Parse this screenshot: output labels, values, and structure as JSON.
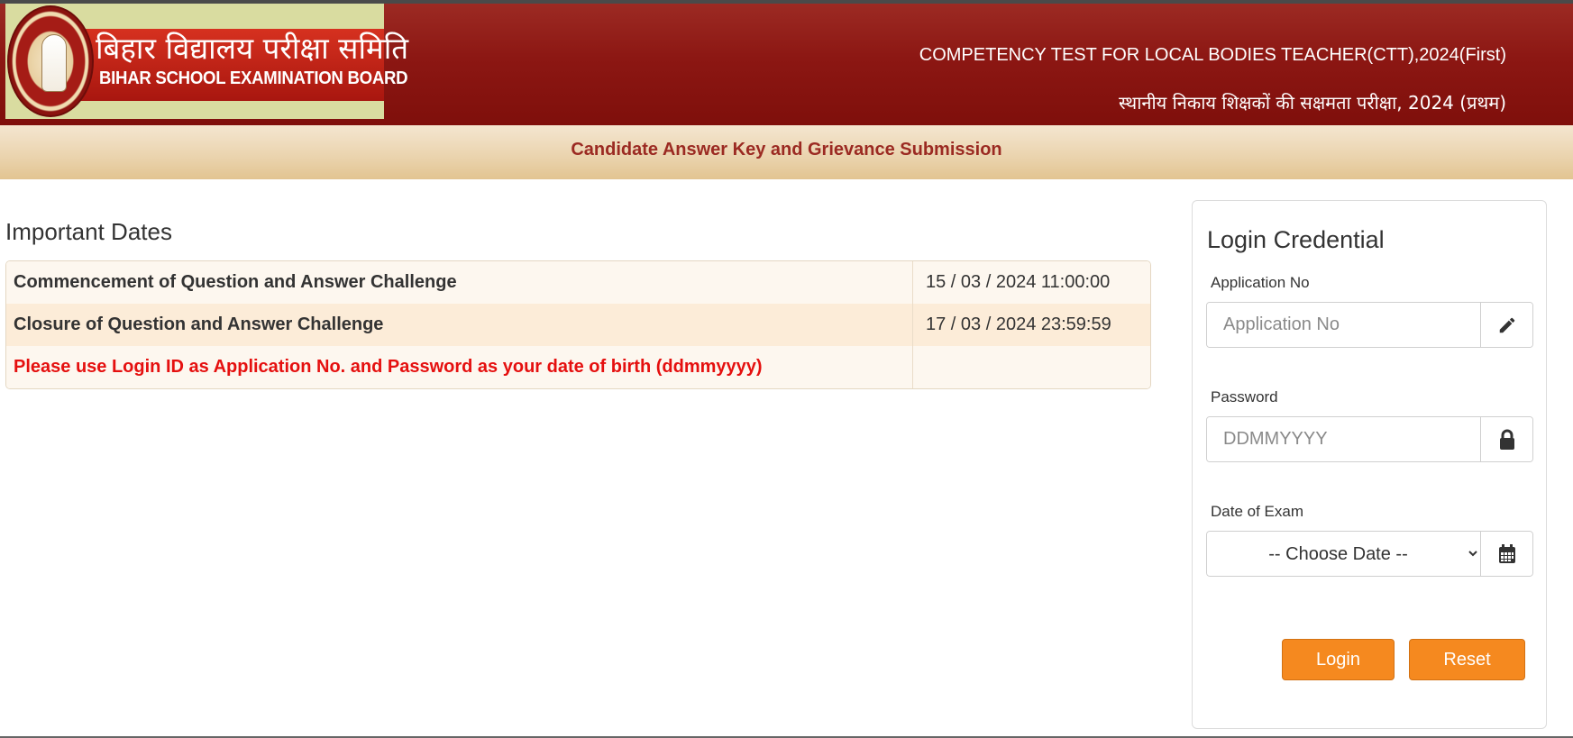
{
  "header": {
    "logo_hindi": "बिहार विद्यालय परीक्षा समिति",
    "logo_english": "BIHAR SCHOOL EXAMINATION BOARD",
    "title_english": "COMPETENCY TEST FOR LOCAL BODIES TEACHER(CTT),2024(First)",
    "title_hindi": "स्थानीय निकाय शिक्षकों की सक्षमता परीक्षा, 2024 (प्रथम)"
  },
  "subheader": {
    "title": "Candidate Answer Key and Grievance Submission"
  },
  "important_dates": {
    "heading": "Important Dates",
    "rows": [
      {
        "label": "Commencement of Question and Answer Challenge",
        "value": "15 / 03 / 2024 11:00:00"
      },
      {
        "label": "Closure of Question and Answer Challenge",
        "value": "17 / 03 / 2024 23:59:59"
      },
      {
        "label": "Please use Login ID as Application No. and Password as your date of birth (ddmmyyyy)",
        "value": ""
      }
    ]
  },
  "login": {
    "title": "Login Credential",
    "application_label": "Application No",
    "application_placeholder": "Application No",
    "application_icon": "pencil-icon",
    "password_label": "Password",
    "password_placeholder": "DDMMYYYY",
    "password_icon": "lock-icon",
    "exam_date_label": "Date of Exam",
    "exam_date_selected": "-- Choose Date --",
    "exam_date_icon": "calendar-icon",
    "login_button": "Login",
    "reset_button": "Reset"
  },
  "colors": {
    "header_red": "#8c1713",
    "accent_orange": "#f5891f",
    "warning_red": "#e5100f",
    "subheader_text": "#9b2a22"
  }
}
